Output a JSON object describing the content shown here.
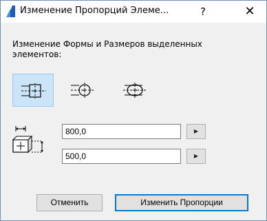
{
  "window": {
    "title": "Изменение Пропорций Элеме...",
    "help_label": "?",
    "close_label": "✕"
  },
  "description": "Изменение Формы и Размеров выделенных элементов:",
  "modes": [
    {
      "name": "rectangular-proportion-icon",
      "selected": true
    },
    {
      "name": "rounded-proportion-icon",
      "selected": false
    },
    {
      "name": "elliptical-proportion-icon",
      "selected": false
    }
  ],
  "width": {
    "value": "800,0",
    "arrow_label": "▶"
  },
  "height": {
    "value": "500,0",
    "arrow_label": "▶"
  },
  "buttons": {
    "cancel_label": "Отменить",
    "apply_label": "Изменить Пропорции"
  },
  "colors": {
    "selection": "#cce4f7",
    "accent": "#0078d7",
    "app_icon": "#1a5fb4"
  }
}
